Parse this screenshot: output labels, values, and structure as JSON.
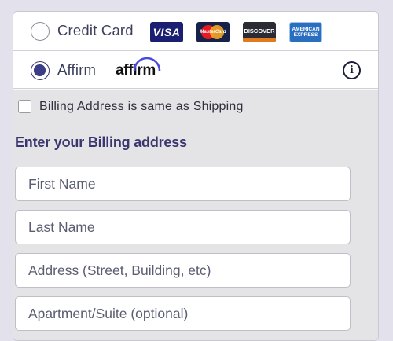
{
  "payment_options": {
    "credit_card": {
      "label": "Credit Card",
      "selected": false
    },
    "affirm": {
      "label": "Affirm",
      "selected": true
    }
  },
  "card_brands": {
    "visa": "VISA",
    "mastercard": "MasterCard",
    "discover": "DISCOVER",
    "amex_line1": "AMERICAN",
    "amex_line2": "EXPRESS"
  },
  "affirm_logo_text": "affirm",
  "billing": {
    "same_as_shipping_label": "Billing Address is same as Shipping",
    "same_as_shipping_checked": false,
    "section_title": "Enter your Billing address",
    "fields": {
      "first_name": {
        "placeholder": "First Name",
        "value": ""
      },
      "last_name": {
        "placeholder": "Last Name",
        "value": ""
      },
      "address": {
        "placeholder": "Address (Street, Building, etc)",
        "value": ""
      },
      "apartment": {
        "placeholder": "Apartment/Suite (optional)",
        "value": ""
      }
    }
  },
  "colors": {
    "accent": "#3d3c86",
    "title": "#3a3770",
    "background": "#e3e1ec"
  },
  "icons": {
    "info": "info-icon"
  }
}
